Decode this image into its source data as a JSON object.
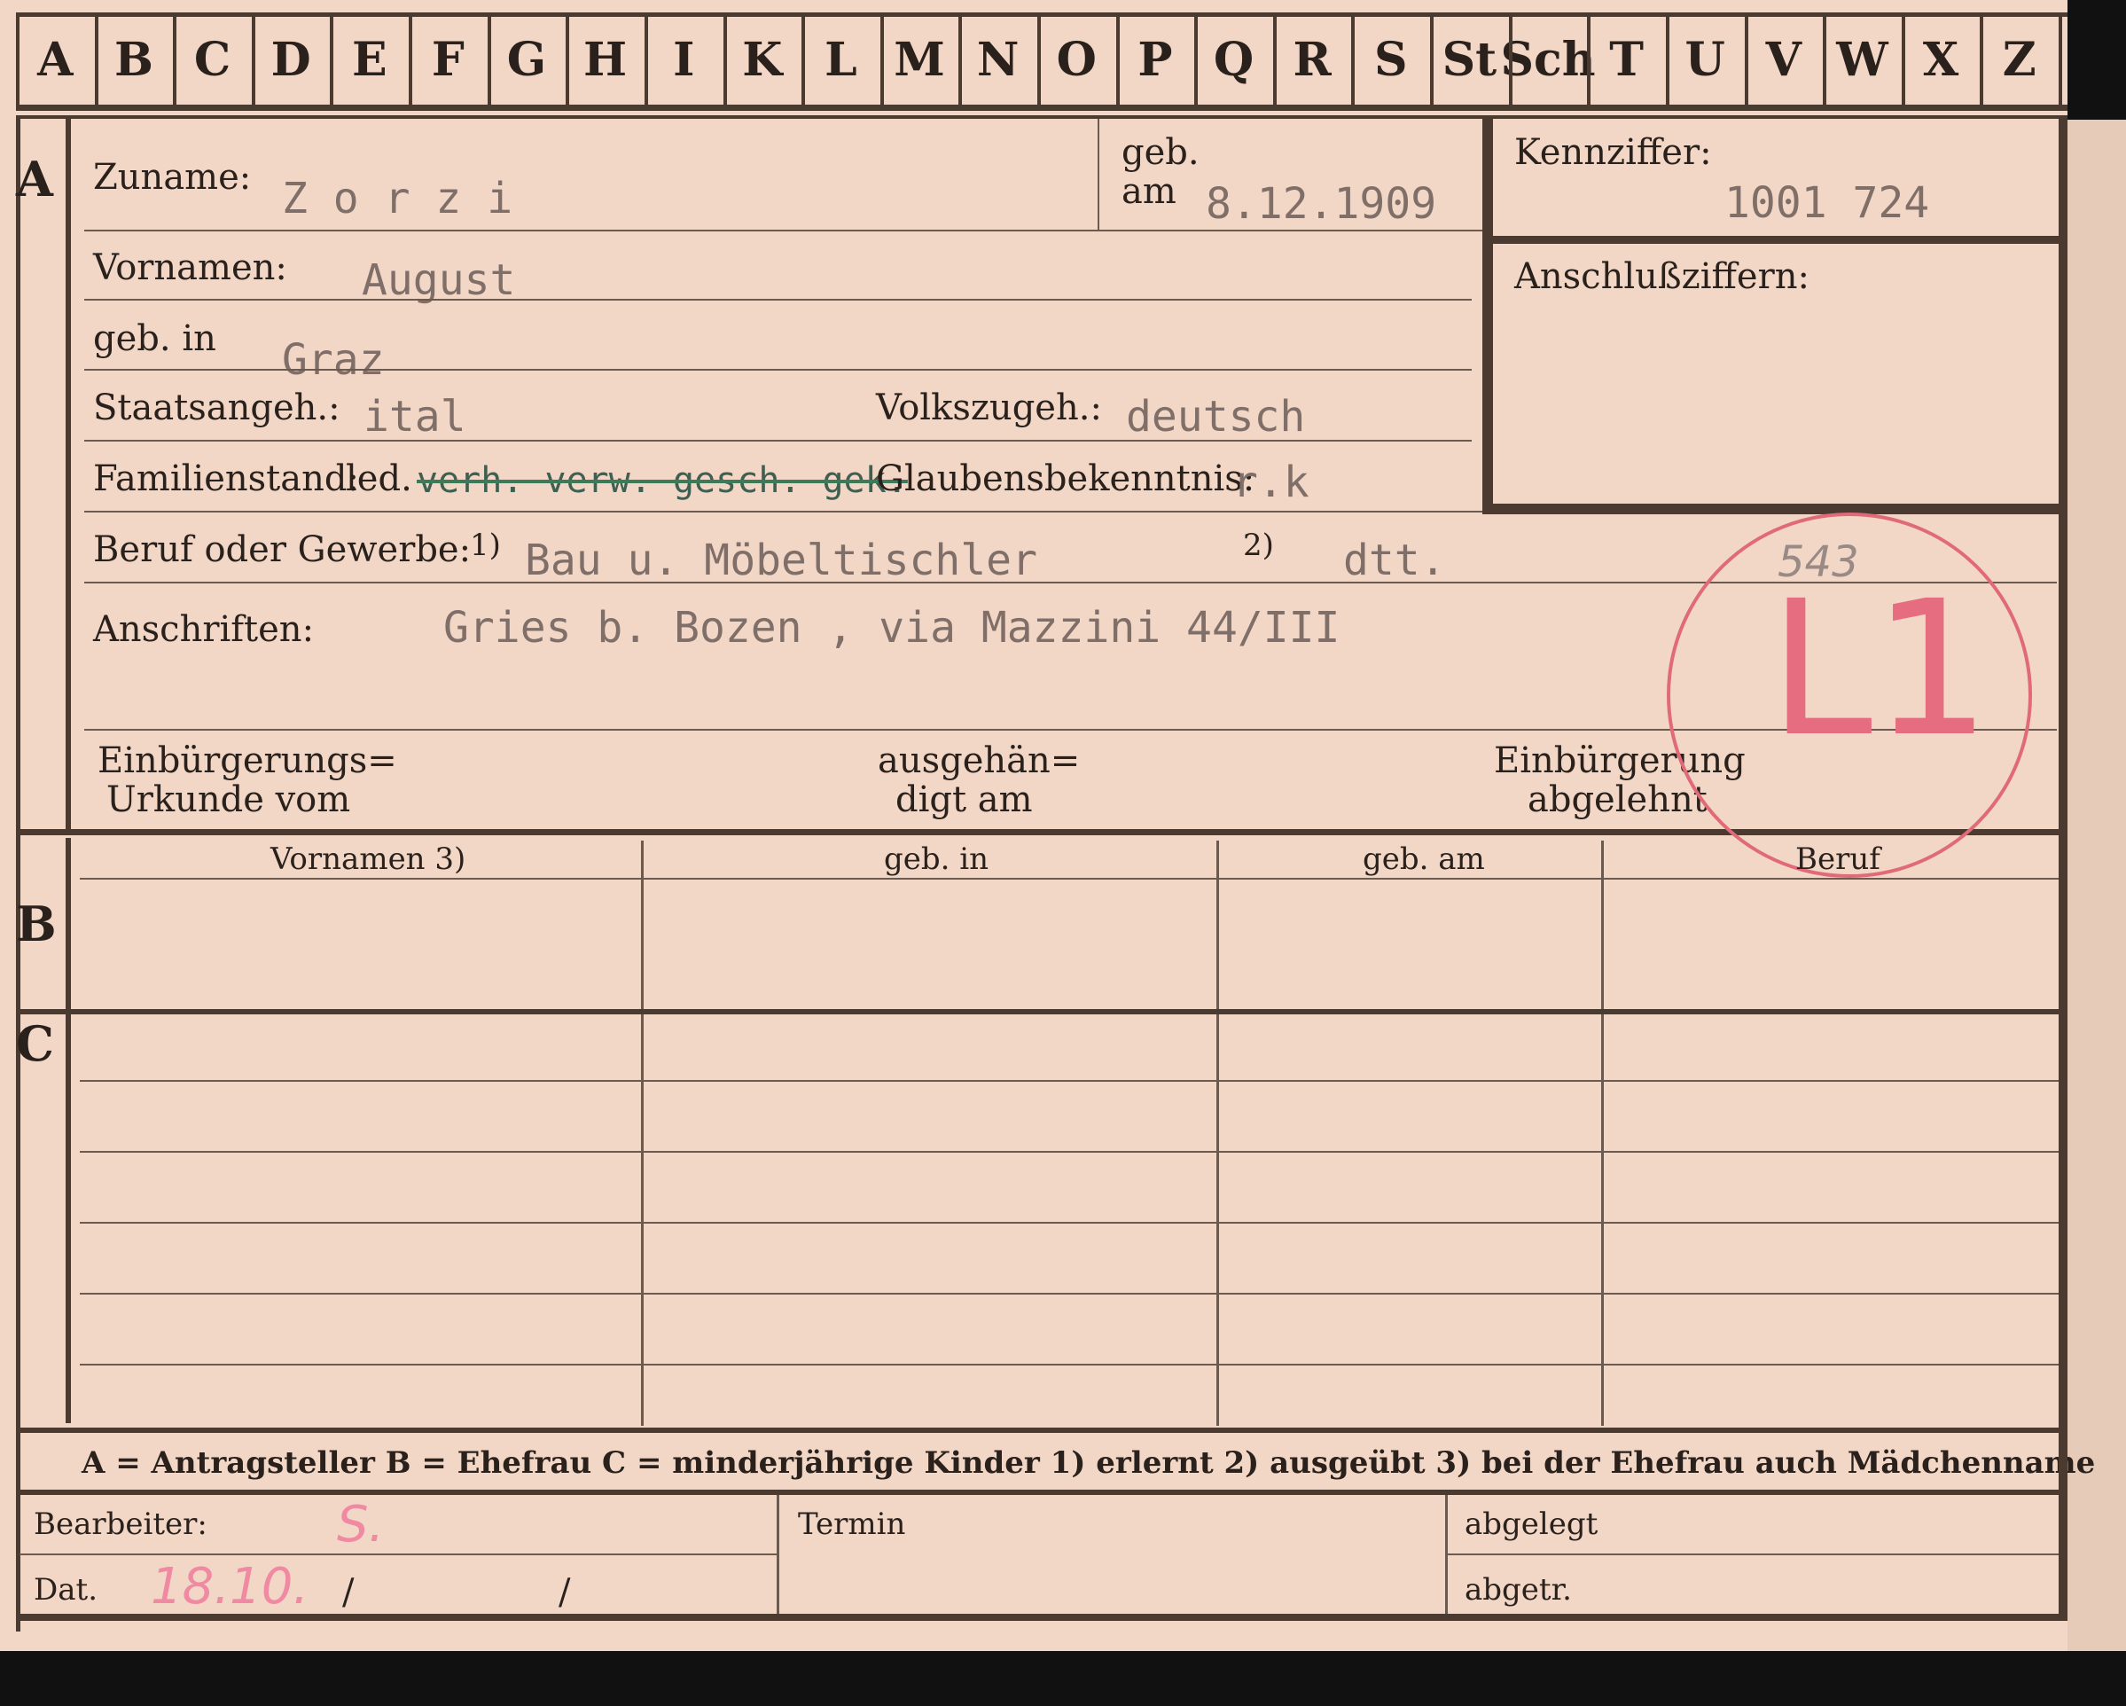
{
  "alphabet": [
    "A",
    "B",
    "C",
    "D",
    "E",
    "F",
    "G",
    "H",
    "I",
    "K",
    "L",
    "M",
    "N",
    "O",
    "P",
    "Q",
    "R",
    "S",
    "St",
    "Sch",
    "T",
    "U",
    "V",
    "W",
    "X",
    "Z"
  ],
  "section_letters": {
    "a": "A",
    "b": "B",
    "c": "C"
  },
  "a": {
    "surname_label": "Zuname:",
    "surname": "Z o r z i",
    "born_on_label_1": "geb.",
    "born_on_label_2": "am",
    "born_on": "8.12.1909",
    "first_names_label": "Vornamen:",
    "first_names": "August",
    "born_in_label": "geb. in",
    "born_in": "Graz",
    "citizenship_label": "Staatsangeh.:",
    "citizenship": "ital",
    "nationality_label": "Volkszugeh.:",
    "nationality": "deutsch",
    "marital_label": "Familienstand:",
    "marital_single": "led.",
    "marital_crossed": "verh. verw. gesch. gek.",
    "religion_label": "Glaubensbekenntnis:",
    "religion": "r.k",
    "occupation_label": "Beruf oder Gewerbe:",
    "occupation_note_1": "1)",
    "occupation_learned": "Bau u. Möbeltischler",
    "occupation_note_2": "2)",
    "occupation_practiced": "dtt.",
    "addresses_label": "Anschriften:",
    "address": "Gries b. Bozen , via Mazzini  44/III",
    "naturalization_label_1": "Einbürgerungs=",
    "naturalization_label_2": "Urkunde vom",
    "handed_label_1": "ausgehän=",
    "handed_label_2": "digt am",
    "refused_label_1": "Einbürgerung",
    "refused_label_2": "abgelehnt"
  },
  "ident": {
    "number_label": "Kennziffer:",
    "number": "1001 724",
    "sub_label": "Anschlußziffern:"
  },
  "stamp": {
    "text": "L1",
    "pencil_number": "543"
  },
  "b_columns": [
    "Vornamen 3)",
    "geb. in",
    "geb. am",
    "Beruf"
  ],
  "legend": "A = Antragsteller  B = Ehefrau  C = minderjährige Kinder  1) erlernt  2) ausgeübt  3) bei der Ehefrau auch Mädchenname",
  "footer": {
    "clerk_label": "Bearbeiter:",
    "clerk_value": "S.",
    "date_label": "Dat.",
    "date_value": "18.10.",
    "slash": "/",
    "termin_label": "Termin",
    "filed_label": "abgelegt",
    "out_label": "abgetr."
  }
}
